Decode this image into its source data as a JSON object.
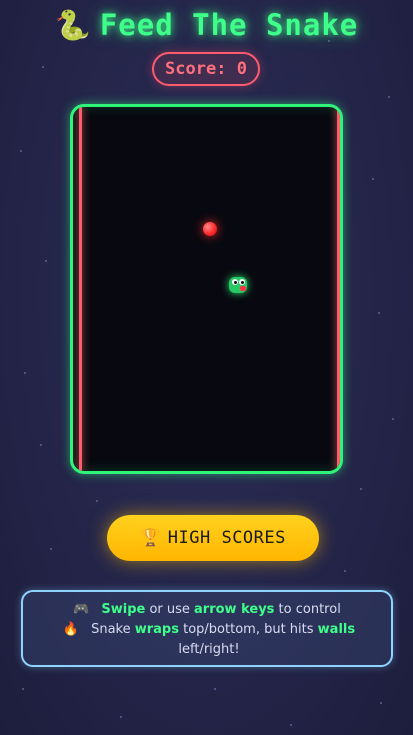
{
  "header": {
    "icon_name": "snake-icon",
    "icon_glyph": "🐍",
    "title": "Feed The Snake"
  },
  "score": {
    "text": "Score: 0",
    "value": 0
  },
  "game_board": {
    "border_color": "#2ef57a",
    "wall_color": "#ff5c6c",
    "food_color": "#ff2a2a",
    "snake_color": "#28c864"
  },
  "high_scores_button": {
    "icon_name": "trophy-icon",
    "icon_glyph": "🏆",
    "label": "HIGH SCORES"
  },
  "instructions": {
    "line1": {
      "icon_name": "gamepad-icon",
      "icon_glyph": "🎮",
      "hl1": "Swipe",
      "t1": " or use ",
      "hl2": "arrow keys",
      "t2": " to control"
    },
    "line2": {
      "icon_name": "fire-icon",
      "icon_glyph": "🔥",
      "t1": "Snake ",
      "hl1": "wraps",
      "t2": " top/bottom, but hits ",
      "hl2": "walls",
      "t3": " left/right!"
    }
  }
}
